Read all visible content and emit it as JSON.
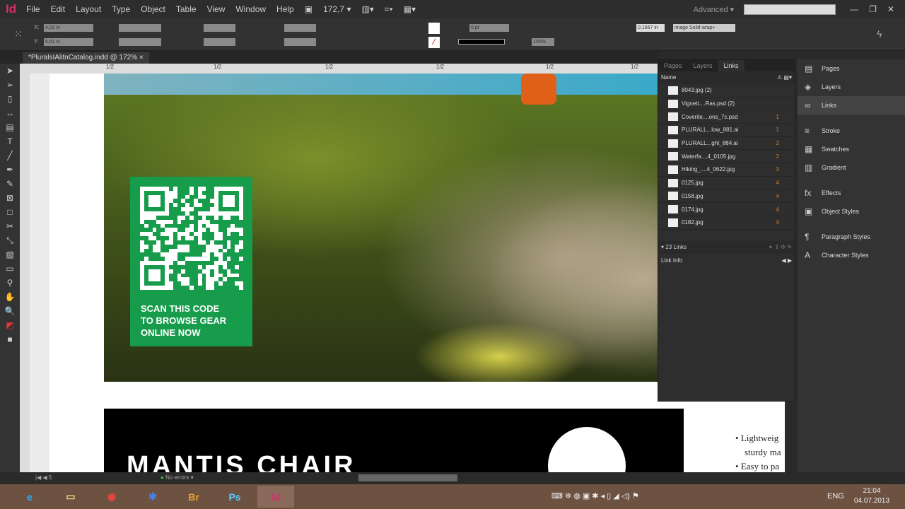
{
  "app": {
    "logo": "Id",
    "menus": [
      "File",
      "Edit",
      "Layout",
      "Type",
      "Object",
      "Table",
      "View",
      "Window",
      "Help"
    ],
    "zoom": "172,7",
    "workspace": "Advanced",
    "search_placeholder": ""
  },
  "control": {
    "x": "4,02 in",
    "y": "5,51 in",
    "stroke_weight": "0 pt",
    "opacity": "100%",
    "inset": "0,1667 in",
    "object_style": "image Solid wrap+"
  },
  "document_tab": "*PluralsIAlitnCatalog.indd @ 172%",
  "ruler_labels": [
    "1/2",
    "1/2",
    "1/2",
    "1/2",
    "1/2",
    "1/2"
  ],
  "qr": {
    "caption": [
      "SCAN THIS CODE",
      "TO BROWSE GEAR",
      "ONLINE NOW"
    ]
  },
  "banner": {
    "title": "MANTIS CHAIR"
  },
  "bullets": [
    "Lightweig",
    "sturdy ma",
    "Easy to pa"
  ],
  "links_panel": {
    "tabs": [
      "Pages",
      "Layers",
      "Links"
    ],
    "column": "Name",
    "items": [
      {
        "name": "8043.jpg (2)",
        "page": ""
      },
      {
        "name": "Vignett....Ras.psd (2)",
        "page": ""
      },
      {
        "name": "Coverite....ons_7c.psd",
        "page": "1"
      },
      {
        "name": "PLURALL...low_881.ai",
        "page": "1"
      },
      {
        "name": "PLURALL...ght_884.ai",
        "page": "2"
      },
      {
        "name": "Waterfa....4_0105.jpg",
        "page": "2"
      },
      {
        "name": "Hiking_....4_0622.jpg",
        "page": "3"
      },
      {
        "name": "0125.jpg",
        "page": "4"
      },
      {
        "name": "0158.jpg",
        "page": "4"
      },
      {
        "name": "0174.jpg",
        "page": "4"
      },
      {
        "name": "0182.jpg",
        "page": "4"
      }
    ],
    "count": "23 Links",
    "link_info": "Link Info"
  },
  "right_panel": [
    {
      "icon": "pages-icon",
      "glyph": "▤",
      "label": "Pages"
    },
    {
      "icon": "layers-icon",
      "glyph": "◈",
      "label": "Layers"
    },
    {
      "icon": "links-icon",
      "glyph": "∞",
      "label": "Links"
    },
    {
      "icon": "stroke-icon",
      "glyph": "≡",
      "label": "Stroke"
    },
    {
      "icon": "swatches-icon",
      "glyph": "▦",
      "label": "Swatches"
    },
    {
      "icon": "gradient-icon",
      "glyph": "▥",
      "label": "Gradient"
    },
    {
      "icon": "effects-icon",
      "glyph": "fx",
      "label": "Effects"
    },
    {
      "icon": "object-styles-icon",
      "glyph": "▣",
      "label": "Object Styles"
    },
    {
      "icon": "paragraph-styles-icon",
      "glyph": "¶",
      "label": "Paragraph Styles"
    },
    {
      "icon": "character-styles-icon",
      "glyph": "A",
      "label": "Character Styles"
    }
  ],
  "status": {
    "page": "5",
    "preflight": "No errors"
  },
  "taskbar": {
    "apps": [
      "e",
      "▭",
      "◉",
      "✻",
      "Br",
      "Ps",
      "Id"
    ],
    "lang": "ENG",
    "time": "21:04",
    "date": "04.07.2013"
  }
}
